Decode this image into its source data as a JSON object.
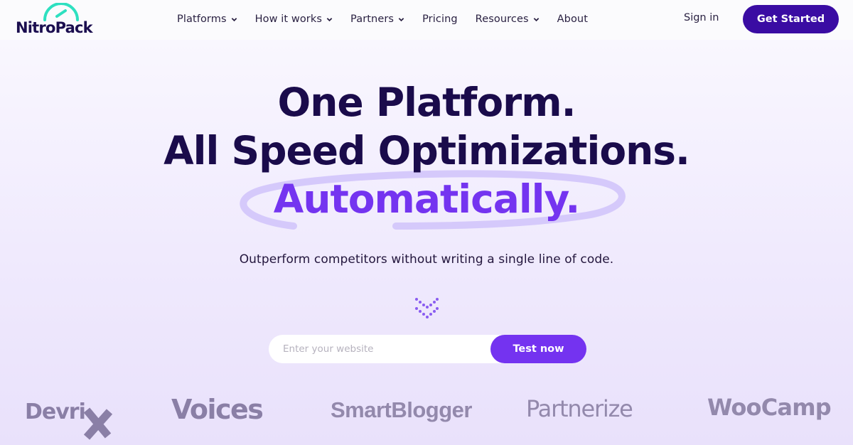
{
  "brand": {
    "name": "NitroPack"
  },
  "nav": {
    "items": [
      {
        "label": "Platforms",
        "has_dropdown": true
      },
      {
        "label": "How it works",
        "has_dropdown": true
      },
      {
        "label": "Partners",
        "has_dropdown": true
      },
      {
        "label": "Pricing",
        "has_dropdown": false
      },
      {
        "label": "Resources",
        "has_dropdown": true
      },
      {
        "label": "About",
        "has_dropdown": false
      }
    ],
    "sign_in": "Sign in",
    "get_started": "Get Started"
  },
  "hero": {
    "line1": "One Platform.",
    "line2": "All Speed Optimizations.",
    "line3": "Automatically.",
    "subtitle": "Outperform competitors without writing a single line of code."
  },
  "search": {
    "placeholder": "Enter your website",
    "value": "",
    "button": "Test now"
  },
  "customers": [
    "Devri",
    "Voices",
    "SmartBlogger",
    "Partnerize",
    "WooCamp"
  ],
  "colors": {
    "primary_dark": "#3a0ca3",
    "accent_purple": "#7433f0",
    "heading": "#1a0b4b",
    "logo_teal": "#2ee0c0"
  }
}
